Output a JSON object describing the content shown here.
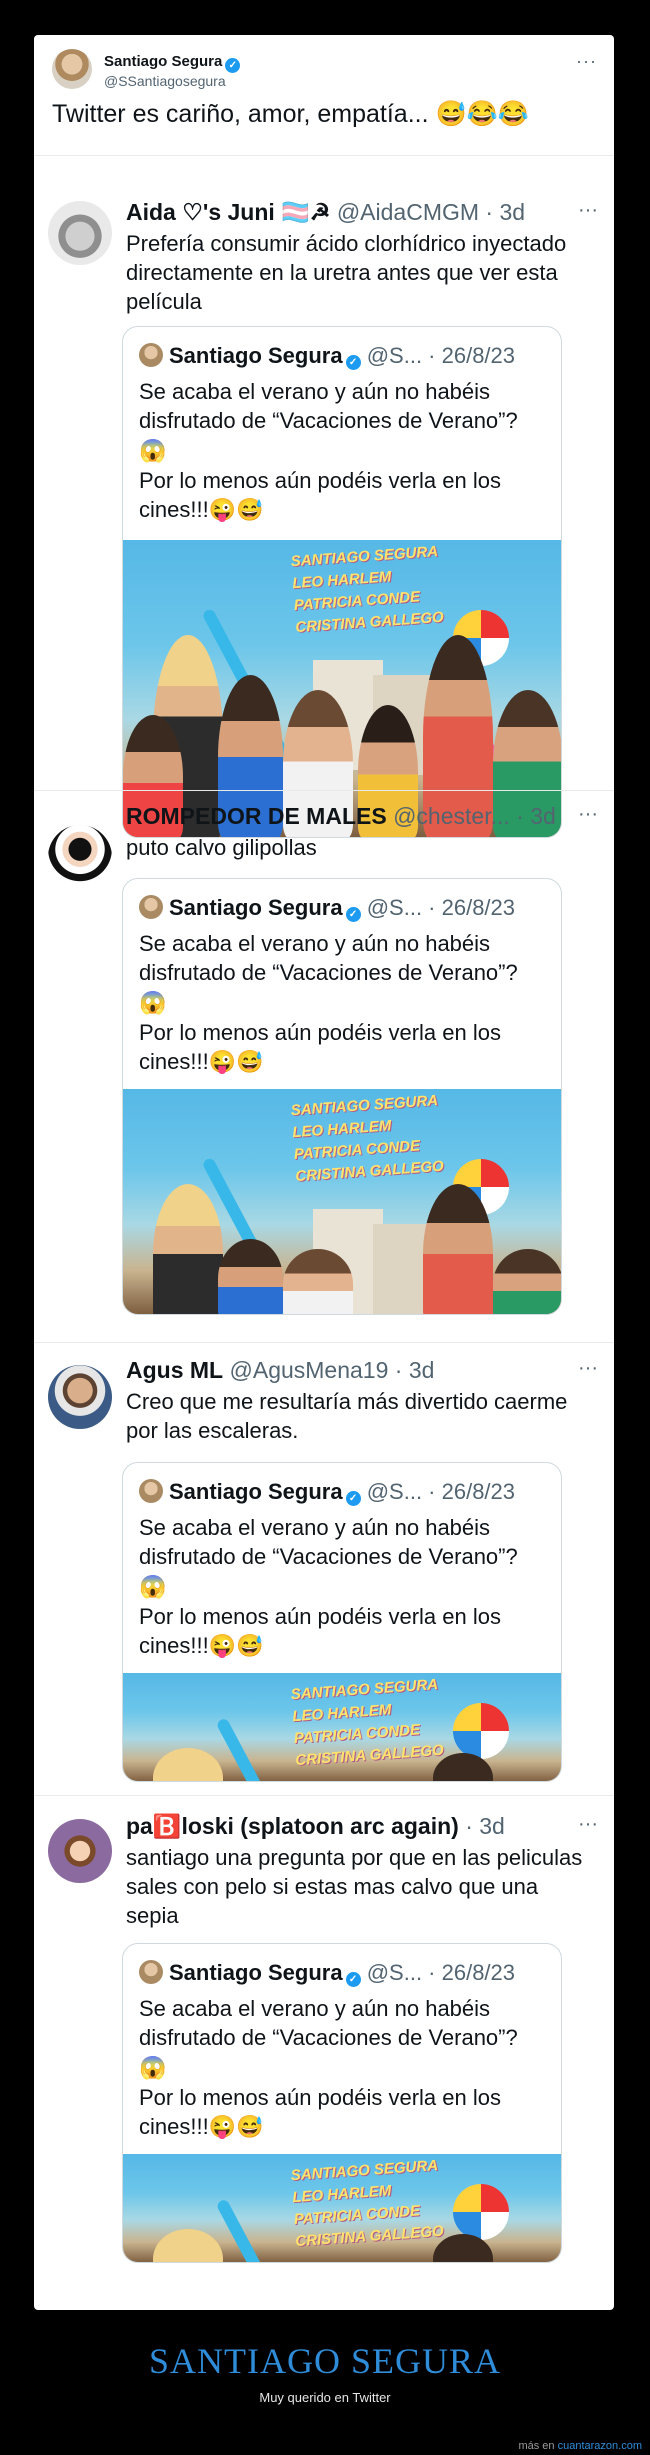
{
  "main_tweet": {
    "name": "Santiago Segura",
    "handle": "@SSantiagosegura",
    "more": "···",
    "text": "Twitter es cariño, amor, empatía... 😅😂😂"
  },
  "quoted_tweet": {
    "name": "Santiago Segura",
    "handle_date": "@S... · 26/8/23",
    "line1": "Se acaba el verano y aún no habéis disfrutado de “Vacaciones de Verano”?",
    "line2": "😱",
    "line3": "Por lo menos aún podéis verla en los cines!!!😜😅",
    "poster_credits": [
      "SANTIAGO SEGURA",
      "LEO HARLEM",
      "PATRICIA CONDE",
      "CRISTINA GALLEGO"
    ]
  },
  "replies": [
    {
      "name": "Aida ♡'s Juni 🏳️‍⚧️☭",
      "handle": "@AidaCMGM · 3d",
      "text": "Prefería consumir ácido clorhídrico inyectado directamente en la uretra antes que ver esta película"
    },
    {
      "name": "ROMPEDOR DE MALES",
      "handle": "@chester... · 3d",
      "text": "puto calvo gilipollas"
    },
    {
      "name": "Agus ML",
      "handle": "@AgusMena19 · 3d",
      "text": "Creo que me resultaría más divertido caerme por las escaleras."
    },
    {
      "name": "pa🅱️loski (splatoon arc again)",
      "handle": "· 3d",
      "text": "santiago una pregunta por que en las peliculas sales con pelo si estas mas calvo que una sepia"
    }
  ],
  "footer": {
    "title": "SANTIAGO SEGURA",
    "subtitle": "Muy querido en Twitter",
    "source_prefix": "más en ",
    "source_link": "cuantarazon.com"
  },
  "colors": {
    "accent": "#1d9bf0",
    "footer_title": "#2f8cd9"
  }
}
